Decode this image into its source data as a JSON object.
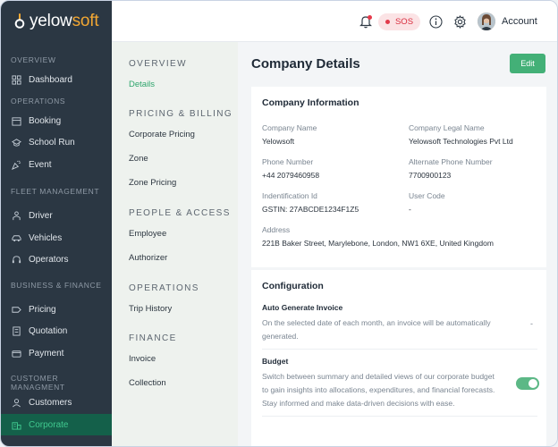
{
  "brand": {
    "name_main": "yelow",
    "name_accent": "soft"
  },
  "sidebar": {
    "sections": [
      {
        "title": "OVERVIEW"
      },
      {
        "title": "OPERATIONS"
      },
      {
        "title": "FLEET MANAGEMENT"
      },
      {
        "title": "BUSINESS & FINANCE"
      },
      {
        "title": "CUSTOMER MANAGMENT"
      }
    ],
    "items": [
      {
        "label": "Dashboard",
        "icon": "dashboard-icon"
      },
      {
        "label": "Booking",
        "icon": "booking-icon"
      },
      {
        "label": "School Run",
        "icon": "school-icon"
      },
      {
        "label": "Event",
        "icon": "event-icon"
      },
      {
        "label": "Driver",
        "icon": "driver-icon"
      },
      {
        "label": "Vehicles",
        "icon": "car-icon"
      },
      {
        "label": "Operators",
        "icon": "headset-icon"
      },
      {
        "label": "Pricing",
        "icon": "tag-icon"
      },
      {
        "label": "Quotation",
        "icon": "document-icon"
      },
      {
        "label": "Payment",
        "icon": "wallet-icon"
      },
      {
        "label": "Customers",
        "icon": "user-icon"
      },
      {
        "label": "Corporate",
        "icon": "building-icon",
        "active": true
      }
    ]
  },
  "topbar": {
    "sos_label": "SOS",
    "account_label": "Account"
  },
  "subnav": {
    "sections": [
      {
        "title": "OVERVIEW",
        "items": [
          "Details"
        ]
      },
      {
        "title": "PRICING & BILLING",
        "items": [
          "Corporate Pricing",
          "Zone",
          "Zone Pricing"
        ]
      },
      {
        "title": "PEOPLE & ACCESS",
        "items": [
          "Employee",
          "Authorizer"
        ]
      },
      {
        "title": "OPERATIONS",
        "items": [
          "Trip History"
        ]
      },
      {
        "title": "FINANCE",
        "items": [
          "Invoice",
          "Collection"
        ]
      }
    ],
    "active": "Details"
  },
  "main": {
    "title": "Company Details",
    "edit_label": "Edit",
    "company_info": {
      "title": "Company Information",
      "fields": [
        {
          "label": "Company Name",
          "value": "Yelowsoft"
        },
        {
          "label": "Company Legal Name",
          "value": "Yelowsoft Technologies Pvt Ltd"
        },
        {
          "label": "Phone Number",
          "value": "+44 2079460958"
        },
        {
          "label": "Alternate Phone Number",
          "value": "7700900123"
        },
        {
          "label": "Indentification Id",
          "value": "GSTIN: 27ABCDE1234F1Z5"
        },
        {
          "label": "User Code",
          "value": "-"
        },
        {
          "label": "Address",
          "value": "221B Baker Street, Marylebone, London, NW1 6XE, United Kingdom"
        }
      ]
    },
    "configuration": {
      "title": "Configuration",
      "auto_invoice": {
        "title": "Auto Generate Invoice",
        "desc_line1": "On the selected date of each month, an invoice will be automatically",
        "desc_line2": "generated.",
        "value": "-"
      },
      "budget": {
        "title": "Budget",
        "desc_line1": "Switch between summary and detailed views of our corporate budget",
        "desc_line2": "to gain insights into allocations, expenditures, and financial forecasts.",
        "desc_line3": "Stay informed and make data-driven decisions with ease.",
        "toggle_on": true
      }
    }
  },
  "colors": {
    "sidebar_bg": "#2b3743",
    "accent_green": "#43b077",
    "active_green": "#40c98f",
    "brand_orange": "#f2a733",
    "sos_red": "#d92d3e"
  }
}
